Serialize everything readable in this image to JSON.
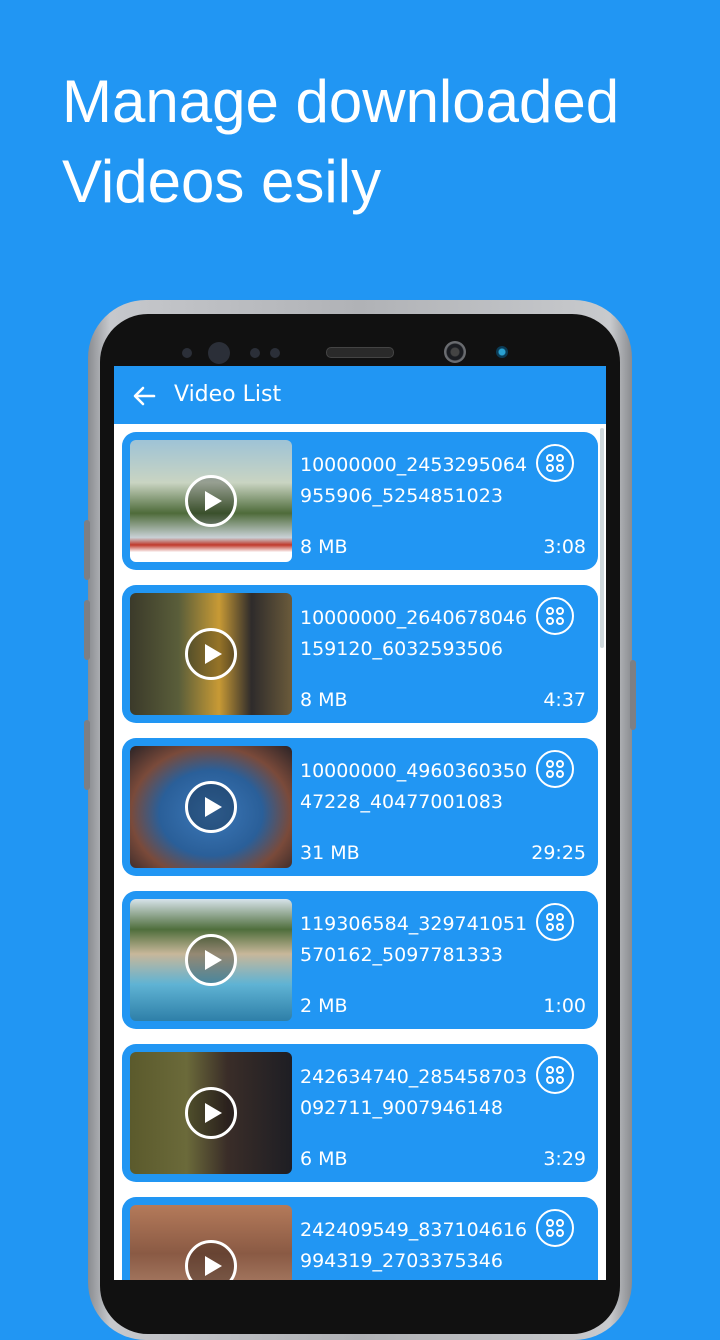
{
  "headline": {
    "line1": "Manage downloaded",
    "line2": "Videos esily"
  },
  "app_bar": {
    "title": "Video List",
    "back_icon": "arrow-left-icon"
  },
  "videos": [
    {
      "name": "10000000_2453295064955906_5254851023",
      "size": "8 MB",
      "duration": "3:08"
    },
    {
      "name": "10000000_2640678046159120_6032593506",
      "size": "8 MB",
      "duration": "4:37"
    },
    {
      "name": "10000000_496036035047228_40477001083",
      "size": "31 MB",
      "duration": "29:25"
    },
    {
      "name": "119306584_329741051570162_5097781333",
      "size": "2 MB",
      "duration": "1:00"
    },
    {
      "name": "242634740_285458703092711_9007946148",
      "size": "6 MB",
      "duration": "3:29"
    },
    {
      "name": "242409549_837104616994319_2703375346",
      "size": "",
      "duration": ""
    }
  ],
  "icons": {
    "more": "more-options-icon",
    "play": "play-icon"
  },
  "colors": {
    "background": "#2196f3",
    "card": "#2196f3",
    "screen": "#ffffff"
  }
}
